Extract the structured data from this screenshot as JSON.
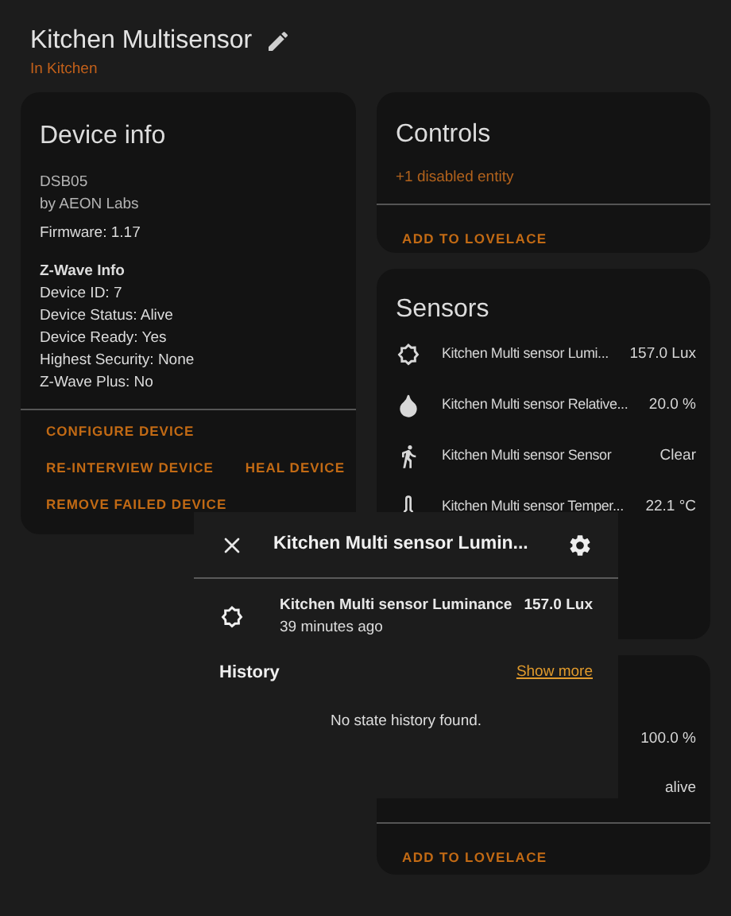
{
  "header": {
    "title": "Kitchen Multisensor",
    "area": "In Kitchen"
  },
  "device_info": {
    "title": "Device info",
    "model": "DSB05",
    "manufacturer": "by AEON Labs",
    "firmware": "Firmware: 1.17",
    "zwave_title": "Z-Wave Info",
    "zwave_lines": [
      "Device ID: 7",
      "Device Status: Alive",
      "Device Ready: Yes",
      "Highest Security: None",
      "Z-Wave Plus: No"
    ],
    "action_rows": [
      [
        "CONFIGURE DEVICE"
      ],
      [
        "RE-INTERVIEW DEVICE",
        "HEAL DEVICE"
      ],
      [
        "REMOVE FAILED DEVICE"
      ]
    ]
  },
  "controls": {
    "title": "Controls",
    "disabled_note": "+1 disabled entity",
    "action": "ADD TO LOVELACE"
  },
  "sensors": {
    "title": "Sensors",
    "entities": [
      {
        "kind": "brightness",
        "name": "Kitchen Multi sensor Lumi...",
        "state": "157.0 Lux"
      },
      {
        "kind": "humidity",
        "name": "Kitchen Multi sensor Relative...",
        "state": "20.0 %"
      },
      {
        "kind": "motion",
        "name": "Kitchen Multi sensor Sensor",
        "state": "Clear"
      },
      {
        "kind": "temperature",
        "name": "Kitchen Multi sensor Temper...",
        "state": "22.1 °C"
      }
    ]
  },
  "diagnostic": {
    "entities": [
      {
        "state": "100.0 %"
      },
      {
        "state": "alive"
      }
    ],
    "action": "ADD TO LOVELACE"
  },
  "dialog": {
    "title": "Kitchen Multi sensor Lumin...",
    "entity": {
      "kind": "brightness",
      "name": "Kitchen Multi sensor Luminance",
      "state": "157.0 Lux",
      "time": "39 minutes ago"
    },
    "history_title": "History",
    "show_more": "Show more",
    "empty": "No state history found."
  }
}
